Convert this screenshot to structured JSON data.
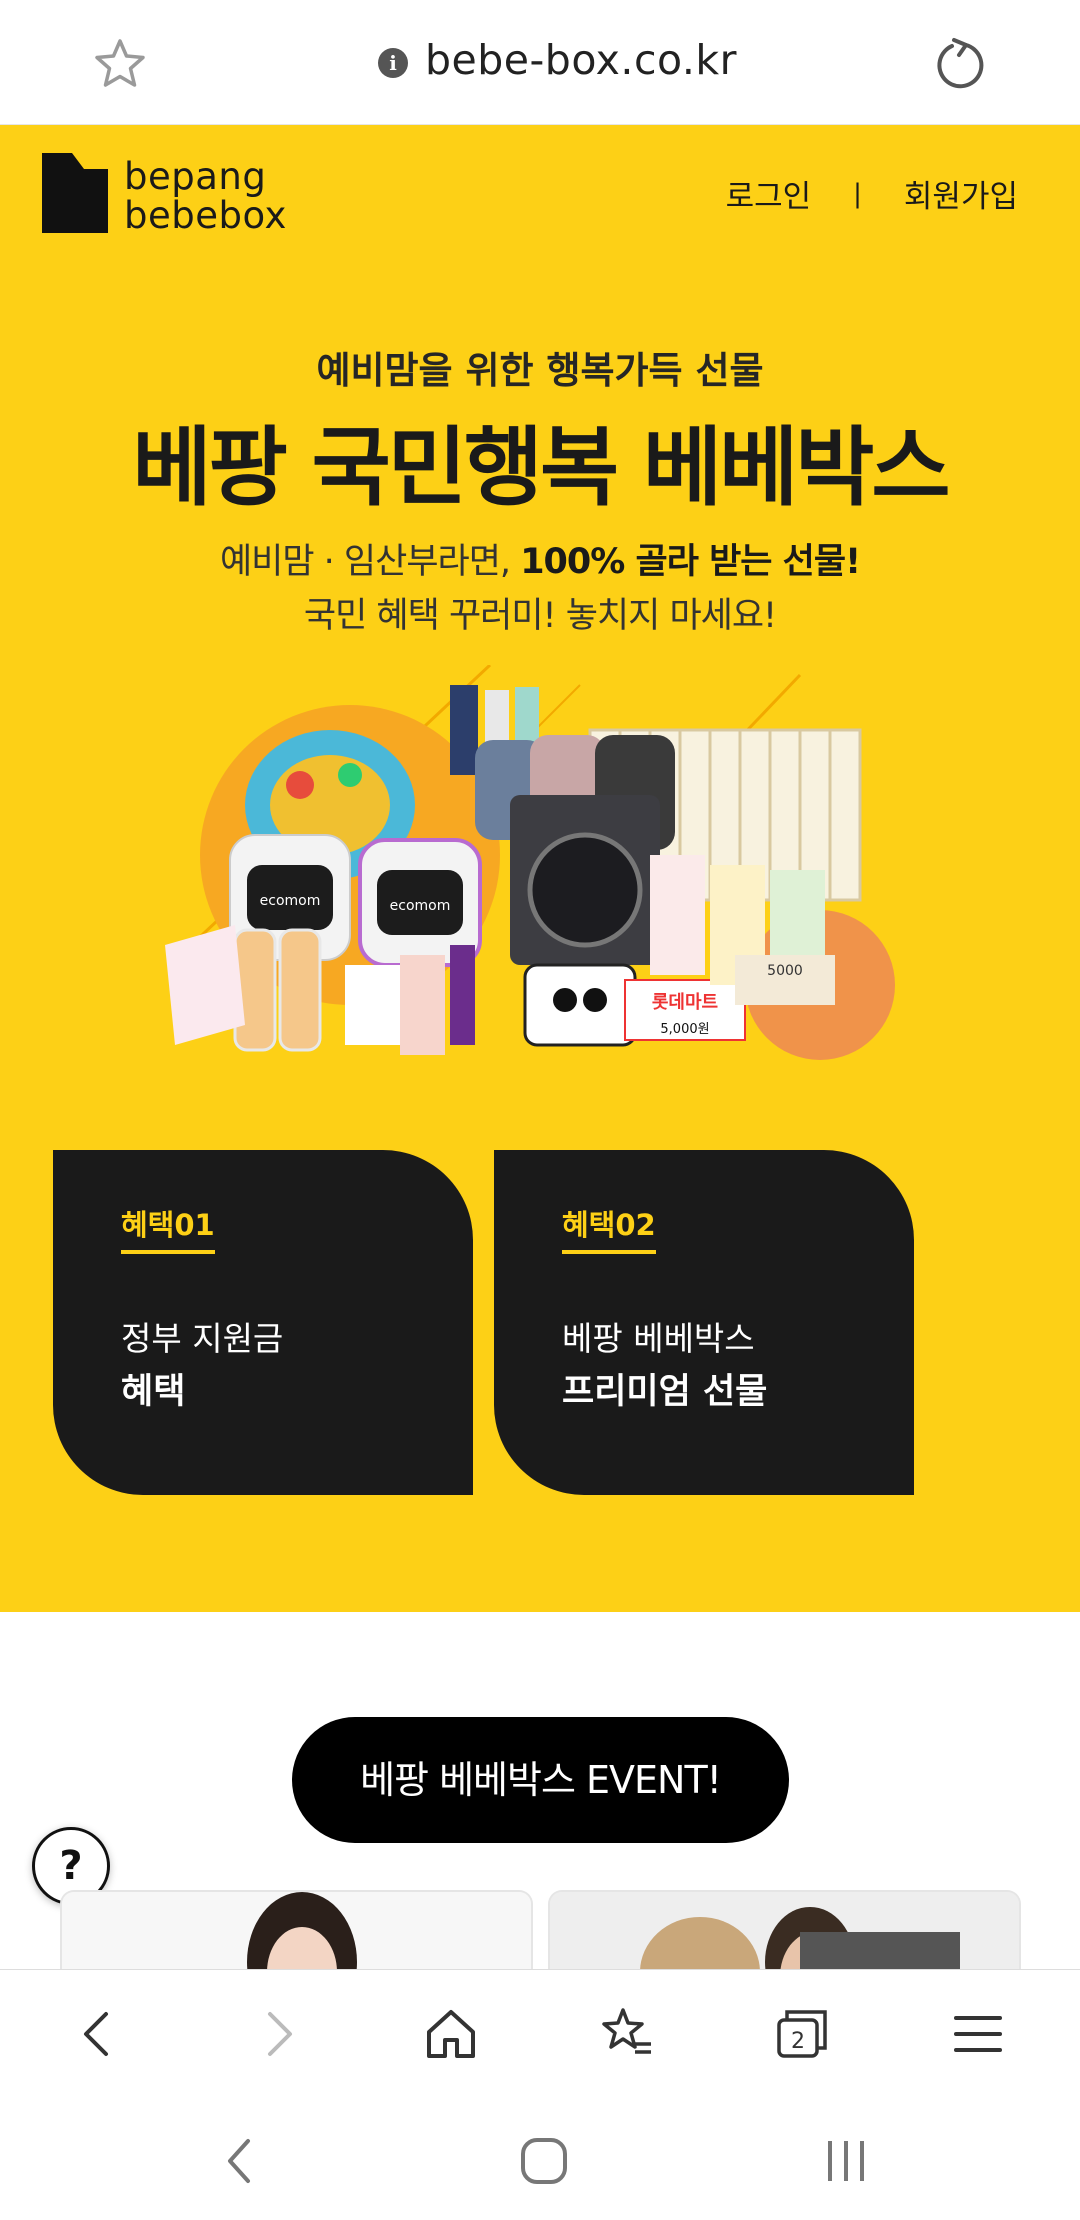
{
  "browser": {
    "url": "bebe-box.co.kr"
  },
  "header": {
    "logo_line1": "bepang",
    "logo_line2": "bebebox",
    "login": "로그인",
    "separator": "|",
    "signup": "회원가입"
  },
  "hero": {
    "subtitle": "예비맘을 위한 행복가득 선물",
    "title": "베팡 국민행복 베베박스",
    "desc_line1_normal": "예비맘 · 임산부라면, ",
    "desc_line1_bold": "100% 골라 받는 선물!",
    "desc_line2": "국민 혜택 꾸러미! 놓치지 마세요!",
    "product_label_ecomom": "ecomom",
    "product_label_lotte": "롯데마트",
    "product_label_price": "5,000원",
    "product_label_5000": "5000"
  },
  "benefits": [
    {
      "tag": "혜택01",
      "line1": "정부 지원금",
      "line2": "혜택"
    },
    {
      "tag": "혜택02",
      "line1": "베팡 베베박스",
      "line2": "프리미엄 선물"
    }
  ],
  "event": {
    "button_label": "베팡 베베박스 EVENT!",
    "help_label": "?"
  },
  "bottom_nav": {
    "tabs_count": "2"
  },
  "colors": {
    "brand_yellow": "#FDD016",
    "card_dark": "#1a1a1a"
  }
}
